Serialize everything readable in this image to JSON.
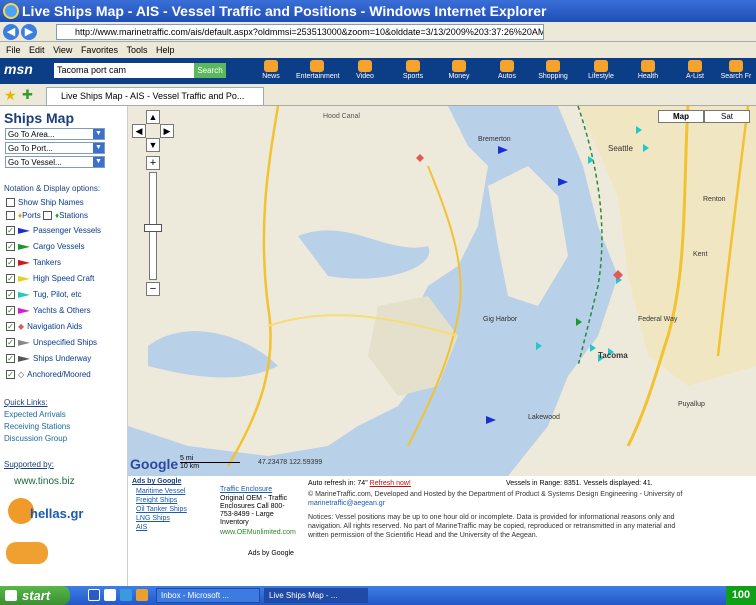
{
  "window": {
    "title": "Live Ships Map - AIS - Vessel Traffic and Positions - Windows Internet Explorer"
  },
  "address": {
    "url": "http://www.marinetraffic.com/ais/default.aspx?oldmmsi=253513000&zoom=10&olddate=3/13/2009%203:37:26%20AM"
  },
  "menu": [
    "File",
    "Edit",
    "View",
    "Favorites",
    "Tools",
    "Help"
  ],
  "msn": {
    "logo": "msn",
    "search_value": "Tacoma port cam",
    "search_button": "Search",
    "items": [
      "News",
      "Entertainment",
      "Video",
      "Sports",
      "Money",
      "Autos",
      "Shopping",
      "Lifestyle",
      "Health",
      "A-List",
      "Search Fr"
    ]
  },
  "tab": {
    "label": "Live Ships Map - AIS - Vessel Traffic and Po..."
  },
  "sidebar": {
    "title": "Ships Map",
    "selects": [
      "Go To Area...",
      "Go To Port...",
      "Go To Vessel..."
    ],
    "options_heading": "Notation & Display options:",
    "show_names": "Show Ship Names",
    "ports": "Ports",
    "stations": "Stations",
    "legend": [
      {
        "label": "Passenger Vessels",
        "color": "#1a2fd0"
      },
      {
        "label": "Cargo Vessels",
        "color": "#1a9a2a"
      },
      {
        "label": "Tankers",
        "color": "#d01a1a"
      },
      {
        "label": "High Speed Craft",
        "color": "#e8d020"
      },
      {
        "label": "Tug, Pilot, etc",
        "color": "#20c8c8"
      },
      {
        "label": "Yachts & Others",
        "color": "#d020d0"
      },
      {
        "label": "Navigation Aids",
        "color": "#e05a5a"
      },
      {
        "label": "Unspecified Ships",
        "color": "#888888"
      },
      {
        "label": "Ships Underway",
        "color": "#555555"
      },
      {
        "label": "Anchored/Moored",
        "color": "#555555"
      }
    ],
    "quick_links_heading": "Quick Links:",
    "quick_links": [
      "Expected Arrivals",
      "Receiving Stations",
      "Discussion Group"
    ],
    "supported_by": "Supported by:",
    "tinos": "www.tinos.biz",
    "hellas": "hellas.gr"
  },
  "map": {
    "map_button": "Map",
    "sat_button": "Sat",
    "google": "Google",
    "scale_top": "5 mi",
    "scale_bottom": "10 km",
    "coords": "47.23478 122.59399",
    "places": [
      "Hood Canal",
      "Bremerton",
      "Seattle",
      "Renton",
      "Kent",
      "Federal Way",
      "Tacoma",
      "Lakewood",
      "Puyallup",
      "Gig Harbor"
    ]
  },
  "bottom": {
    "ads_by_google": "Ads by Google",
    "ad_links": [
      "Maritime Vessel",
      "Freight Ships",
      "Oil Tanker Ships",
      "LNG Ships",
      "AIS"
    ],
    "traffic_title": "Traffic Enclosure",
    "traffic_text": [
      "Original OEM - Traffic",
      "Enclosures Call 800-",
      "753-8499 - Large",
      "Inventory"
    ],
    "traffic_url": "www.OEMunlimited.com",
    "ads_by_google_2": "Ads by Google",
    "refresh_prefix": "Auto refresh in: 74\"",
    "refresh_link": "Refresh now!",
    "vessels_text": "Vessels in Range: 8351. Vessels displayed: 41.",
    "copyright": "© MarineTraffic.com, Developed and Hosted by the Department of Product & Systems Design Engineering - University of",
    "copyright2": "navigation. All rights reserved. No part of MarineTraffic may be copied, reproduced or retransmitted in any material and",
    "email": "marinetraffic@aegean.gr",
    "notice": "Notices: Vessel positions may be up to one hour old or incomplete. Data is provided for informational reasons only and",
    "notice2": "written permission of the Scientific Head and the University of the Aegean."
  },
  "taskbar": {
    "start": "start",
    "tasks": [
      "Inbox - Microsoft ...",
      "Live Ships Map - ..."
    ],
    "tray": "100"
  }
}
